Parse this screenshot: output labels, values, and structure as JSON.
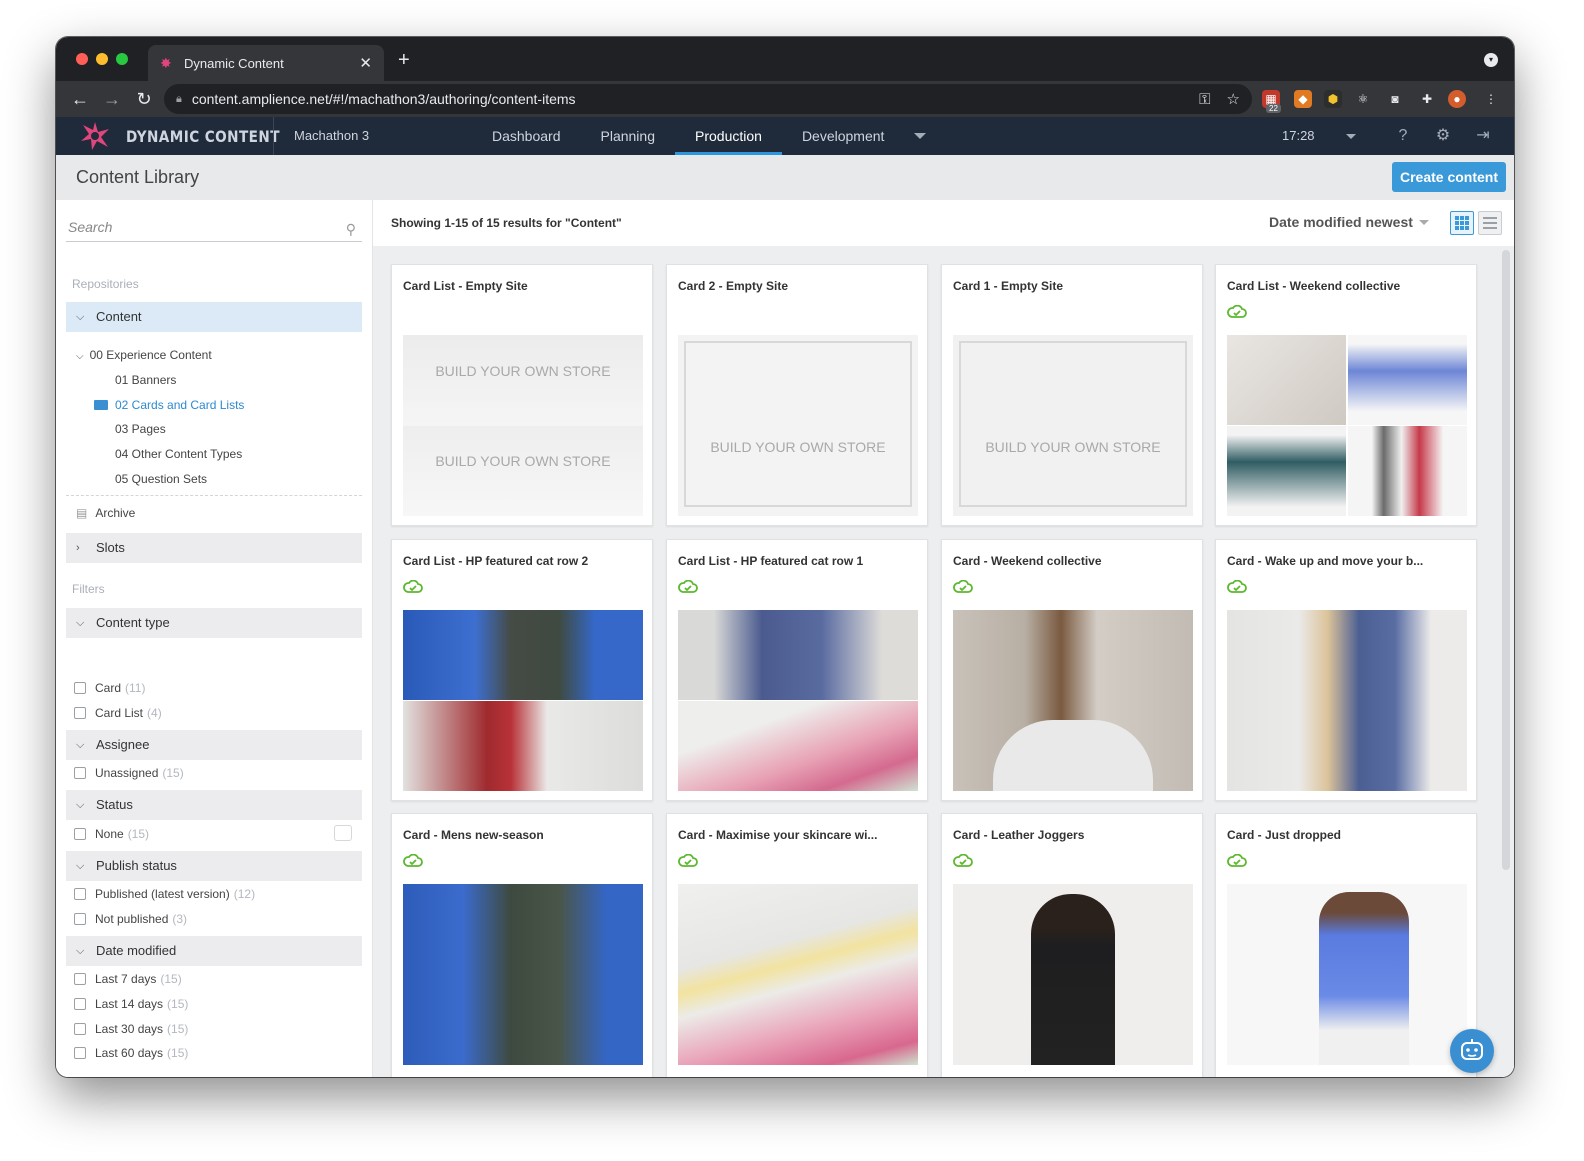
{
  "browser": {
    "tab_title": "Dynamic Content",
    "url": "content.amplience.net/#!/machathon3/authoring/content-items",
    "badge": "22"
  },
  "app": {
    "brand": "DYNAMIC CONTENT",
    "hub": "Machathon 3",
    "nav": [
      "Dashboard",
      "Planning",
      "Production",
      "Development"
    ],
    "active_nav": "Production",
    "clock": "17:28"
  },
  "titlebar": {
    "title": "Content Library",
    "create_label": "Create content"
  },
  "sidebar": {
    "search_placeholder": "Search",
    "repositories_label": "Repositories",
    "content_label": "Content",
    "tree": {
      "root": "00 Experience Content",
      "children": [
        "01 Banners",
        "02 Cards and Card Lists",
        "03 Pages",
        "04 Other Content Types",
        "05 Question Sets"
      ],
      "active": "02 Cards and Card Lists"
    },
    "archive_label": "Archive",
    "slots_label": "Slots",
    "filters_label": "Filters",
    "groups": [
      {
        "title": "Content type",
        "options": [
          {
            "label": "Card",
            "count": "(11)"
          },
          {
            "label": "Card List",
            "count": "(4)"
          }
        ]
      },
      {
        "title": "Assignee",
        "options": [
          {
            "label": "Unassigned",
            "count": "(15)"
          }
        ]
      },
      {
        "title": "Status",
        "options": [
          {
            "label": "None",
            "count": "(15)"
          }
        ]
      },
      {
        "title": "Publish status",
        "options": [
          {
            "label": "Published (latest version)",
            "count": "(12)"
          },
          {
            "label": "Not published",
            "count": "(3)"
          }
        ]
      },
      {
        "title": "Date modified",
        "options": [
          {
            "label": "Last 7 days",
            "count": "(15)"
          },
          {
            "label": "Last 14 days",
            "count": "(15)"
          },
          {
            "label": "Last 30 days",
            "count": "(15)"
          },
          {
            "label": "Last 60 days",
            "count": "(15)"
          }
        ]
      }
    ]
  },
  "main": {
    "results_text": "Showing 1-15 of 15 results for \"Content\"",
    "sort_label": "Date modified newest",
    "placeholder_text": "BUILD YOUR OWN STORE",
    "cards": [
      {
        "title": "Card List - Empty Site",
        "published": false
      },
      {
        "title": "Card 2 - Empty Site",
        "published": false
      },
      {
        "title": "Card 1 - Empty Site",
        "published": false
      },
      {
        "title": "Card List - Weekend collective",
        "published": true
      },
      {
        "title": "Card List - HP featured cat row 2",
        "published": true
      },
      {
        "title": "Card List - HP featured cat row 1",
        "published": true
      },
      {
        "title": "Card - Weekend collective",
        "published": true
      },
      {
        "title": "Card - Wake up and move your b...",
        "published": true
      },
      {
        "title": "Card - Mens new-season",
        "published": true
      },
      {
        "title": "Card - Maximise your skincare wi...",
        "published": true
      },
      {
        "title": "Card - Leather Joggers",
        "published": true
      },
      {
        "title": "Card - Just dropped",
        "published": true
      }
    ]
  },
  "colors": {
    "accent": "#3a99d9",
    "header": "#1f2a3a",
    "published_icon": "#5cb82e"
  }
}
